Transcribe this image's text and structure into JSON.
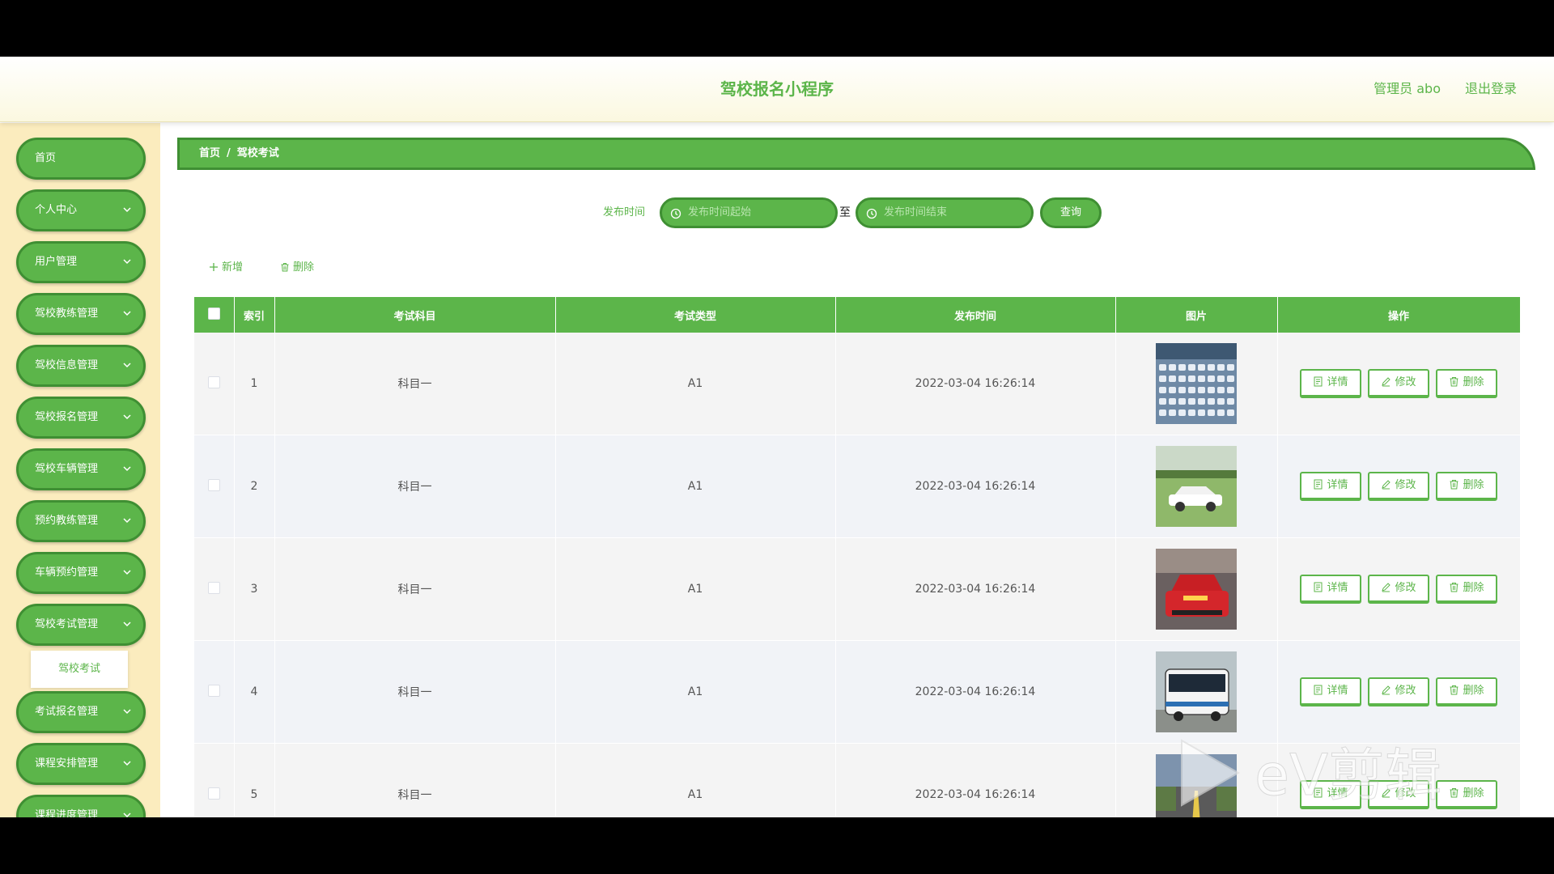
{
  "header": {
    "title": "驾校报名小程序",
    "user": "管理员 abo",
    "logout": "退出登录"
  },
  "sidebar": {
    "items": [
      {
        "label": "首页",
        "has_chevron": false
      },
      {
        "label": "个人中心",
        "has_chevron": true
      },
      {
        "label": "用户管理",
        "has_chevron": true
      },
      {
        "label": "驾校教练管理",
        "has_chevron": true
      },
      {
        "label": "驾校信息管理",
        "has_chevron": true
      },
      {
        "label": "驾校报名管理",
        "has_chevron": true
      },
      {
        "label": "驾校车辆管理",
        "has_chevron": true
      },
      {
        "label": "预约教练管理",
        "has_chevron": true
      },
      {
        "label": "车辆预约管理",
        "has_chevron": true
      },
      {
        "label": "驾校考试管理",
        "has_chevron": true
      },
      {
        "label": "考试报名管理",
        "has_chevron": true
      },
      {
        "label": "课程安排管理",
        "has_chevron": true
      },
      {
        "label": "课程进度管理",
        "has_chevron": true
      }
    ],
    "submenu": {
      "label": "驾校考试"
    }
  },
  "breadcrumb": {
    "home": "首页",
    "separator": "/",
    "current": "驾校考试"
  },
  "search": {
    "label": "发布时间",
    "start_placeholder": "发布时间起始",
    "to": "至",
    "end_placeholder": "发布时间结束",
    "button": "查询"
  },
  "actions": {
    "add": "新增",
    "delete": "删除"
  },
  "table": {
    "headers": [
      "索引",
      "考试科目",
      "考试类型",
      "发布时间",
      "图片",
      "操作"
    ],
    "rows": [
      {
        "index": "1",
        "subject": "科目一",
        "type": "A1",
        "time": "2022-03-04 16:26:14",
        "image": "parking-lot-cars"
      },
      {
        "index": "2",
        "subject": "科目一",
        "type": "A1",
        "time": "2022-03-04 16:26:14",
        "image": "white-car-on-field"
      },
      {
        "index": "3",
        "subject": "科目一",
        "type": "A1",
        "time": "2022-03-04 16:26:14",
        "image": "red-training-car"
      },
      {
        "index": "4",
        "subject": "科目一",
        "type": "A1",
        "time": "2022-03-04 16:26:14",
        "image": "bus"
      },
      {
        "index": "5",
        "subject": "科目一",
        "type": "A1",
        "time": "2022-03-04 16:26:14",
        "image": "road-scene"
      }
    ],
    "op_labels": {
      "detail": "详情",
      "edit": "修改",
      "delete": "删除"
    }
  },
  "watermark": {
    "text": "eV剪辑"
  },
  "colors": {
    "primary": "#5cb54a",
    "primary_dark": "#3f8f33",
    "sidebar_bg": "#fbecbe",
    "header_bg": "#fbf8e0"
  }
}
